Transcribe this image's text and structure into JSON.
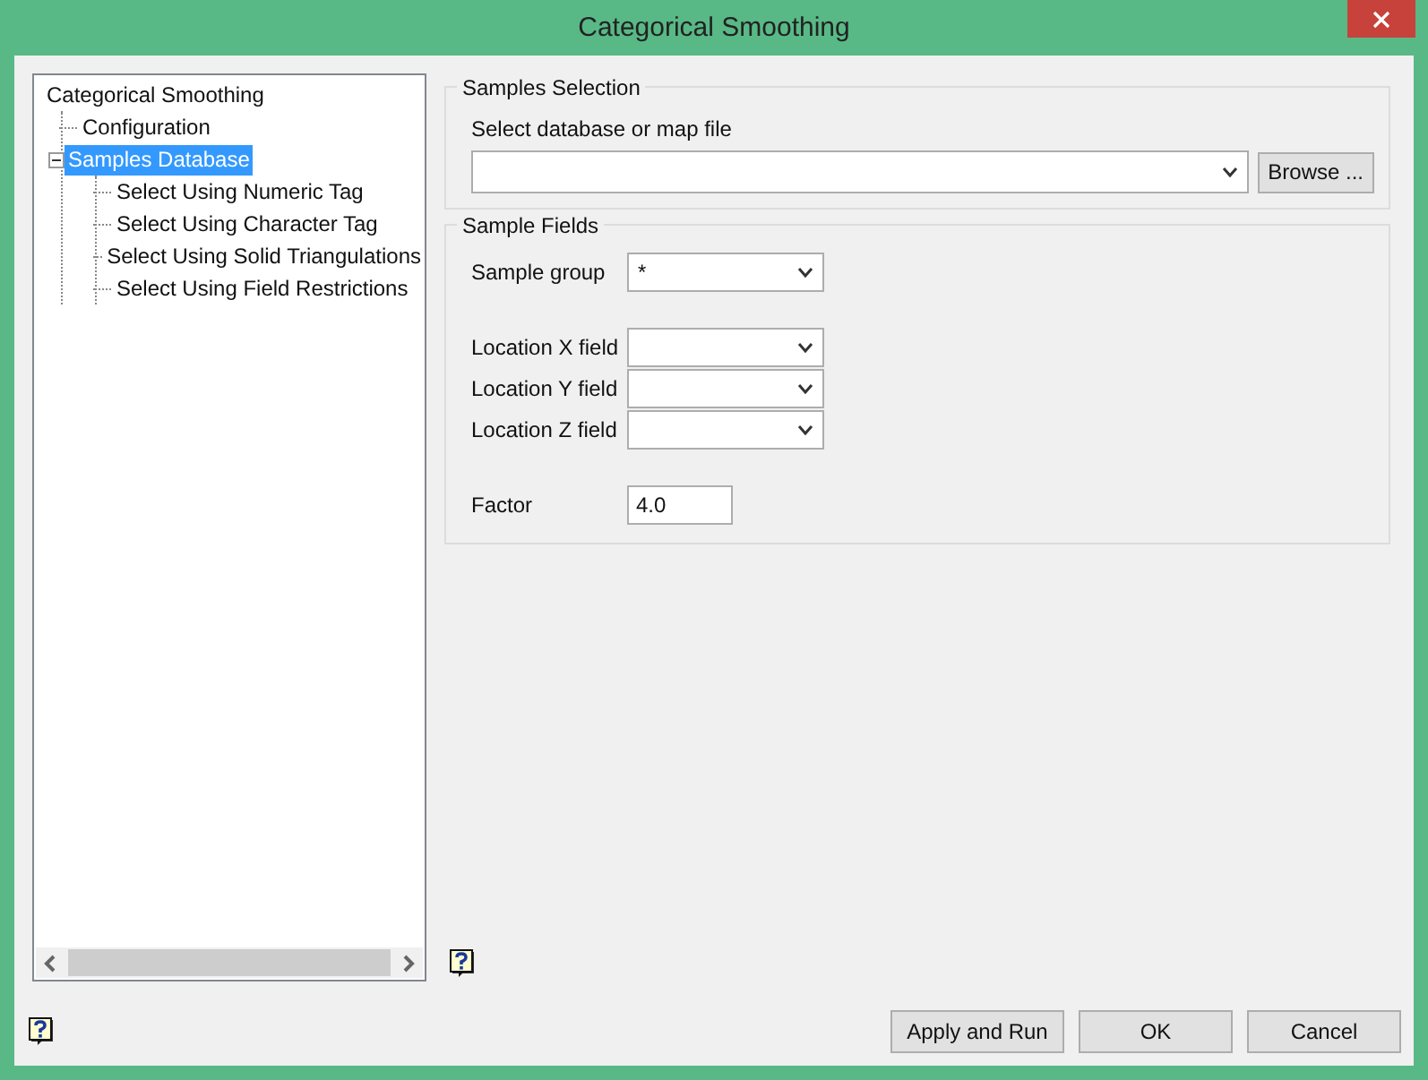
{
  "window": {
    "title": "Categorical Smoothing"
  },
  "tree": [
    {
      "label": "Categorical Smoothing",
      "selected": false,
      "children": [
        {
          "label": "Configuration",
          "selected": false
        },
        {
          "label": "Samples Database",
          "selected": true,
          "expanded": true,
          "children": [
            {
              "label": "Select Using Numeric Tag",
              "selected": false
            },
            {
              "label": "Select Using Character Tag",
              "selected": false
            },
            {
              "label": "Select Using Solid Triangulations",
              "selected": false
            },
            {
              "label": "Select Using Field Restrictions",
              "selected": false
            }
          ]
        }
      ]
    }
  ],
  "samples_selection": {
    "title": "Samples Selection",
    "label": "Select database or map file",
    "browse_button": "Browse ..."
  },
  "sample_fields": {
    "title": "Sample Fields",
    "field_groups": [
      [
        {
          "label": "Sample group",
          "kind": "combo",
          "value": "*"
        }
      ],
      [
        {
          "label": "Location X field",
          "kind": "combo"
        },
        {
          "label": "Location Y field",
          "kind": "combo"
        },
        {
          "label": "Location Z field",
          "kind": "combo"
        }
      ],
      [
        {
          "label": "Factor",
          "kind": "text",
          "value": "4.0"
        }
      ]
    ]
  },
  "buttons": [
    "Apply and Run",
    "OK",
    "Cancel"
  ]
}
